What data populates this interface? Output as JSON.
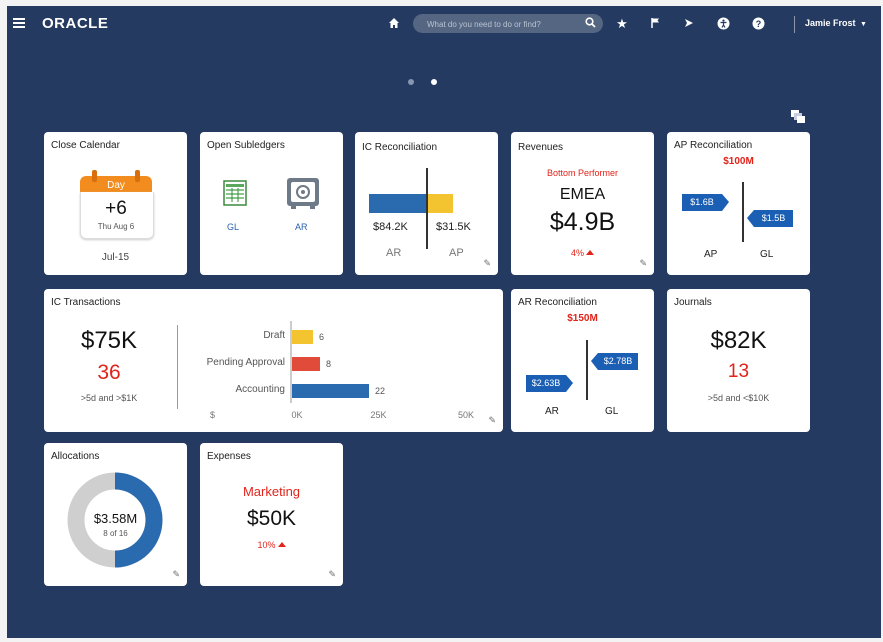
{
  "header": {
    "brand": "ORACLE",
    "search_placeholder": "What do you need to do or find?",
    "user_name": "Jamie Frost"
  },
  "tiles": {
    "close_calendar": {
      "title": "Close Calendar",
      "day_label": "Day",
      "value": "+6",
      "date": "Thu Aug 6",
      "period": "Jul-15"
    },
    "open_subledgers": {
      "title": "Open Subledgers",
      "gl": "GL",
      "ar": "AR"
    },
    "ic_reconciliation": {
      "title": "IC Reconciliation",
      "ar_value": "$84.2K",
      "ap_value": "$31.5K",
      "ar": "AR",
      "ap": "AP"
    },
    "revenues": {
      "title": "Revenues",
      "subtitle": "Bottom Performer",
      "region": "EMEA",
      "value": "$4.9B",
      "change": "4%"
    },
    "ap_reconciliation": {
      "title": "AP Reconciliation",
      "diff": "$100M",
      "left_value": "$1.6B",
      "right_value": "$1.5B",
      "left_label": "AP",
      "right_label": "GL"
    },
    "ic_transactions": {
      "title": "IC Transactions",
      "amount": "$75K",
      "count": "36",
      "note": ">5d and >$1K",
      "axis_unit": "$",
      "ticks": [
        "0K",
        "25K",
        "50K"
      ]
    },
    "ar_reconciliation": {
      "title": "AR Reconciliation",
      "diff": "$150M",
      "left_value": "$2.63B",
      "right_value": "$2.78B",
      "left_label": "AR",
      "right_label": "GL"
    },
    "journals": {
      "title": "Journals",
      "amount": "$82K",
      "count": "13",
      "note": ">5d and <$10K"
    },
    "allocations": {
      "title": "Allocations",
      "amount": "$3.58M",
      "sub": "8 of 16",
      "fraction": 0.5
    },
    "expenses": {
      "title": "Expenses",
      "category": "Marketing",
      "amount": "$50K",
      "change": "10%"
    }
  },
  "chart_data": {
    "type": "bar",
    "orientation": "horizontal",
    "categories": [
      "Draft",
      "Pending Approval",
      "Accounting"
    ],
    "values": [
      6,
      8,
      22
    ],
    "colors": [
      "#f4c430",
      "#e04b3a",
      "#2a6bb0"
    ],
    "xlim": [
      0,
      50
    ],
    "xtick_labels": [
      "0K",
      "25K",
      "50K"
    ]
  },
  "colors": {
    "background": "#243a61",
    "accent_blue": "#1b5fb5",
    "alert_red": "#e2231a",
    "calendar_orange": "#f28c1e"
  }
}
